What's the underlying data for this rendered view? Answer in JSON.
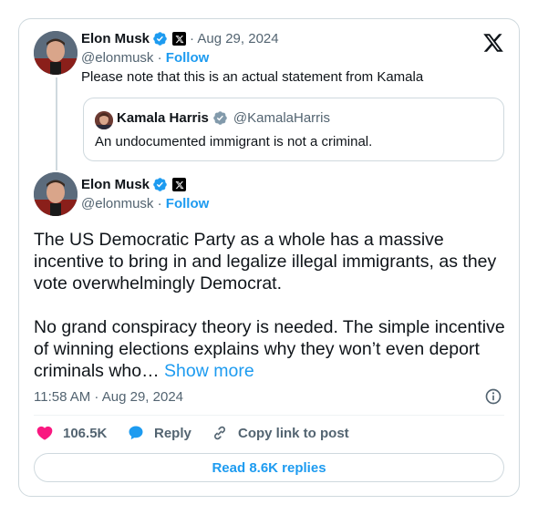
{
  "parent_tweet": {
    "author_name": "Elon Musk",
    "meta": "· Aug 29, 2024",
    "handle": "@elonmusk",
    "separator": "·",
    "follow_label": "Follow",
    "text": "Please note that this is an actual statement from Kamala",
    "quote": {
      "author_name": "Kamala Harris",
      "handle": "@KamalaHarris",
      "text": "An undocumented immigrant is not a criminal."
    }
  },
  "main_tweet": {
    "author_name": "Elon Musk",
    "handle": "@elonmusk",
    "separator": "·",
    "follow_label": "Follow",
    "paragraph1": "The US Democratic Party as a whole has a massive incentive to bring in and legalize illegal immigrants, as they vote overwhelmingly Democrat.",
    "paragraph2": "No grand conspiracy theory is needed. The simple incentive of winning elections explains why they won’t even deport criminals who…",
    "show_more": "Show more",
    "timestamp": "11:58 AM · Aug 29, 2024"
  },
  "actions": {
    "likes": "106.5K",
    "reply_label": "Reply",
    "copy_label": "Copy link to post",
    "read_replies": "Read 8.6K replies"
  },
  "colors": {
    "accent": "#1d9bf0",
    "like": "#f91880",
    "secondary_text": "#536471",
    "border": "#cfd9de"
  },
  "icons": [
    "x-logo-icon",
    "verified-badge-icon",
    "x-org-badge-icon",
    "gray-verified-badge-icon",
    "info-icon",
    "heart-icon",
    "reply-bubble-icon",
    "link-icon"
  ]
}
